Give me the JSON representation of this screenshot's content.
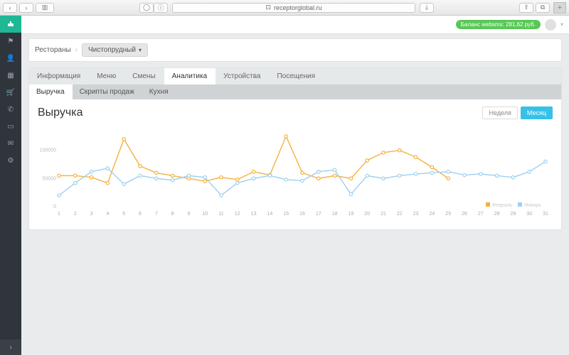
{
  "browser": {
    "url_host": "receptorglobal.ru",
    "lock": "⊡"
  },
  "balance": "Баланс websms: 281,62 руб.",
  "sidebar": {
    "items": [
      "flag",
      "user",
      "dashboard",
      "cart",
      "phone",
      "card",
      "mail",
      "gear"
    ]
  },
  "breadcrumb": {
    "root": "Рестораны",
    "current": "Чистопрудный"
  },
  "tabs": {
    "primary": [
      "Информация",
      "Меню",
      "Смены",
      "Аналитика",
      "Устройства",
      "Посещения"
    ],
    "primary_active": 3,
    "secondary": [
      "Выручка",
      "Скрипты продаж",
      "Кухня"
    ],
    "secondary_active": 0
  },
  "panel": {
    "title": "Выручка",
    "range_buttons": [
      "Неделя",
      "Месяц"
    ],
    "range_active": 1
  },
  "chart_data": {
    "type": "line",
    "xlabel": "",
    "ylabel": "",
    "ylim": [
      0,
      140000
    ],
    "yticks": [
      0,
      50000,
      100000
    ],
    "categories": [
      1,
      2,
      3,
      4,
      5,
      6,
      7,
      8,
      9,
      10,
      11,
      12,
      13,
      14,
      15,
      16,
      17,
      18,
      19,
      20,
      21,
      22,
      23,
      24,
      25,
      26,
      27,
      28,
      29,
      30,
      31
    ],
    "series": [
      {
        "name": "Февраль",
        "color": "#f5b13d",
        "values": [
          55000,
          55000,
          52000,
          42000,
          120000,
          72000,
          60000,
          55000,
          50000,
          45000,
          52000,
          48000,
          62000,
          56000,
          125000,
          60000,
          50000,
          55000,
          50000,
          82000,
          96000,
          100000,
          88000,
          70000,
          50000,
          null,
          null,
          null,
          null,
          null,
          null
        ]
      },
      {
        "name": "Январь",
        "color": "#9ed0f0",
        "values": [
          20000,
          42000,
          62000,
          68000,
          40000,
          55000,
          50000,
          47000,
          55000,
          52000,
          20000,
          42000,
          50000,
          55000,
          48000,
          46000,
          62000,
          65000,
          22000,
          55000,
          50000,
          55000,
          58000,
          60000,
          62000,
          56000,
          58000,
          55000,
          52000,
          62000,
          80000
        ]
      }
    ],
    "legend": [
      "Февраль",
      "Январь"
    ]
  }
}
